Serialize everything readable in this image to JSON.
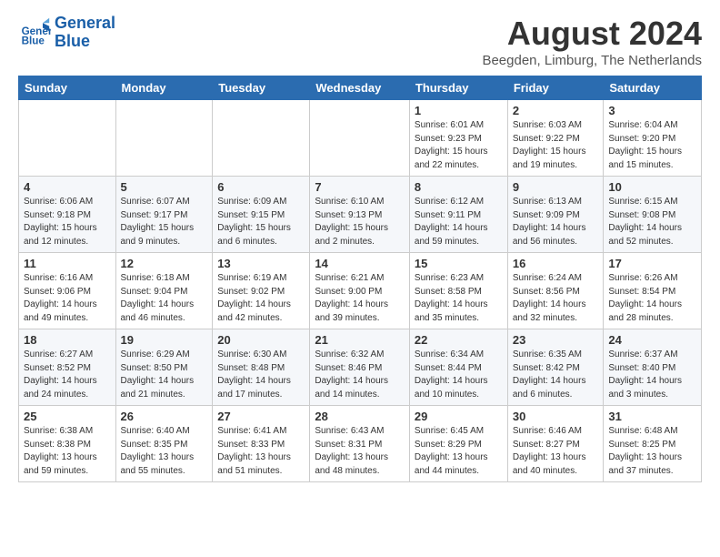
{
  "header": {
    "logo_line1": "General",
    "logo_line2": "Blue",
    "main_title": "August 2024",
    "subtitle": "Beegden, Limburg, The Netherlands"
  },
  "days_of_week": [
    "Sunday",
    "Monday",
    "Tuesday",
    "Wednesday",
    "Thursday",
    "Friday",
    "Saturday"
  ],
  "weeks": [
    [
      {
        "num": "",
        "info": ""
      },
      {
        "num": "",
        "info": ""
      },
      {
        "num": "",
        "info": ""
      },
      {
        "num": "",
        "info": ""
      },
      {
        "num": "1",
        "info": "Sunrise: 6:01 AM\nSunset: 9:23 PM\nDaylight: 15 hours and 22 minutes."
      },
      {
        "num": "2",
        "info": "Sunrise: 6:03 AM\nSunset: 9:22 PM\nDaylight: 15 hours and 19 minutes."
      },
      {
        "num": "3",
        "info": "Sunrise: 6:04 AM\nSunset: 9:20 PM\nDaylight: 15 hours and 15 minutes."
      }
    ],
    [
      {
        "num": "4",
        "info": "Sunrise: 6:06 AM\nSunset: 9:18 PM\nDaylight: 15 hours and 12 minutes."
      },
      {
        "num": "5",
        "info": "Sunrise: 6:07 AM\nSunset: 9:17 PM\nDaylight: 15 hours and 9 minutes."
      },
      {
        "num": "6",
        "info": "Sunrise: 6:09 AM\nSunset: 9:15 PM\nDaylight: 15 hours and 6 minutes."
      },
      {
        "num": "7",
        "info": "Sunrise: 6:10 AM\nSunset: 9:13 PM\nDaylight: 15 hours and 2 minutes."
      },
      {
        "num": "8",
        "info": "Sunrise: 6:12 AM\nSunset: 9:11 PM\nDaylight: 14 hours and 59 minutes."
      },
      {
        "num": "9",
        "info": "Sunrise: 6:13 AM\nSunset: 9:09 PM\nDaylight: 14 hours and 56 minutes."
      },
      {
        "num": "10",
        "info": "Sunrise: 6:15 AM\nSunset: 9:08 PM\nDaylight: 14 hours and 52 minutes."
      }
    ],
    [
      {
        "num": "11",
        "info": "Sunrise: 6:16 AM\nSunset: 9:06 PM\nDaylight: 14 hours and 49 minutes."
      },
      {
        "num": "12",
        "info": "Sunrise: 6:18 AM\nSunset: 9:04 PM\nDaylight: 14 hours and 46 minutes."
      },
      {
        "num": "13",
        "info": "Sunrise: 6:19 AM\nSunset: 9:02 PM\nDaylight: 14 hours and 42 minutes."
      },
      {
        "num": "14",
        "info": "Sunrise: 6:21 AM\nSunset: 9:00 PM\nDaylight: 14 hours and 39 minutes."
      },
      {
        "num": "15",
        "info": "Sunrise: 6:23 AM\nSunset: 8:58 PM\nDaylight: 14 hours and 35 minutes."
      },
      {
        "num": "16",
        "info": "Sunrise: 6:24 AM\nSunset: 8:56 PM\nDaylight: 14 hours and 32 minutes."
      },
      {
        "num": "17",
        "info": "Sunrise: 6:26 AM\nSunset: 8:54 PM\nDaylight: 14 hours and 28 minutes."
      }
    ],
    [
      {
        "num": "18",
        "info": "Sunrise: 6:27 AM\nSunset: 8:52 PM\nDaylight: 14 hours and 24 minutes."
      },
      {
        "num": "19",
        "info": "Sunrise: 6:29 AM\nSunset: 8:50 PM\nDaylight: 14 hours and 21 minutes."
      },
      {
        "num": "20",
        "info": "Sunrise: 6:30 AM\nSunset: 8:48 PM\nDaylight: 14 hours and 17 minutes."
      },
      {
        "num": "21",
        "info": "Sunrise: 6:32 AM\nSunset: 8:46 PM\nDaylight: 14 hours and 14 minutes."
      },
      {
        "num": "22",
        "info": "Sunrise: 6:34 AM\nSunset: 8:44 PM\nDaylight: 14 hours and 10 minutes."
      },
      {
        "num": "23",
        "info": "Sunrise: 6:35 AM\nSunset: 8:42 PM\nDaylight: 14 hours and 6 minutes."
      },
      {
        "num": "24",
        "info": "Sunrise: 6:37 AM\nSunset: 8:40 PM\nDaylight: 14 hours and 3 minutes."
      }
    ],
    [
      {
        "num": "25",
        "info": "Sunrise: 6:38 AM\nSunset: 8:38 PM\nDaylight: 13 hours and 59 minutes."
      },
      {
        "num": "26",
        "info": "Sunrise: 6:40 AM\nSunset: 8:35 PM\nDaylight: 13 hours and 55 minutes."
      },
      {
        "num": "27",
        "info": "Sunrise: 6:41 AM\nSunset: 8:33 PM\nDaylight: 13 hours and 51 minutes."
      },
      {
        "num": "28",
        "info": "Sunrise: 6:43 AM\nSunset: 8:31 PM\nDaylight: 13 hours and 48 minutes."
      },
      {
        "num": "29",
        "info": "Sunrise: 6:45 AM\nSunset: 8:29 PM\nDaylight: 13 hours and 44 minutes."
      },
      {
        "num": "30",
        "info": "Sunrise: 6:46 AM\nSunset: 8:27 PM\nDaylight: 13 hours and 40 minutes."
      },
      {
        "num": "31",
        "info": "Sunrise: 6:48 AM\nSunset: 8:25 PM\nDaylight: 13 hours and 37 minutes."
      }
    ]
  ]
}
